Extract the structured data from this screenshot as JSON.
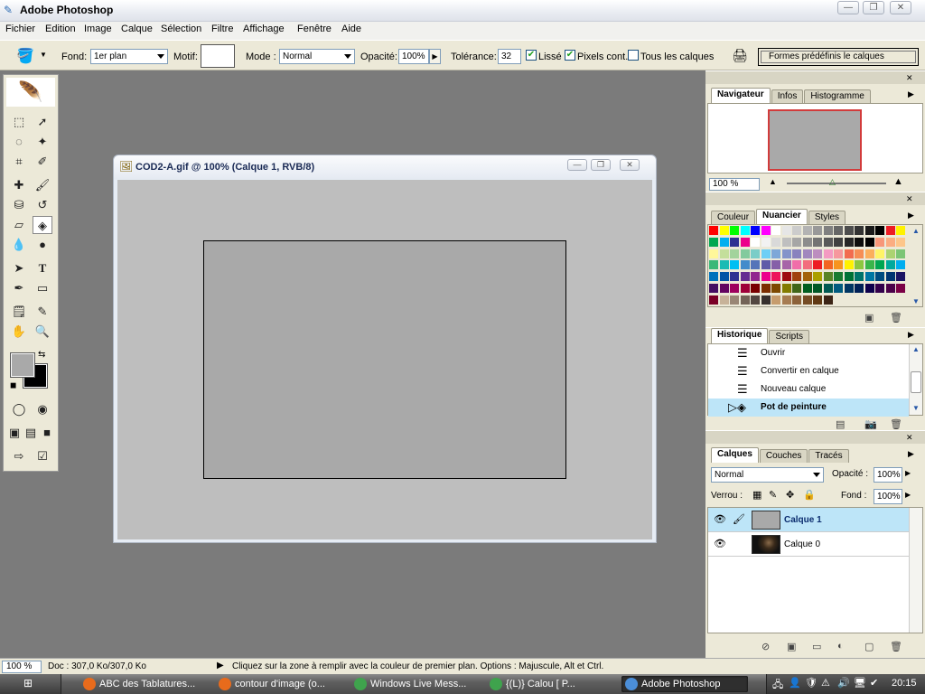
{
  "app": {
    "title": "Adobe Photoshop",
    "window_controls": [
      "—",
      "❐",
      "✕"
    ]
  },
  "menu": [
    "Fichier",
    "Edition",
    "Image",
    "Calque",
    "Sélection",
    "Filtre",
    "Affichage",
    "Fenêtre",
    "Aide"
  ],
  "options": {
    "fond_label": "Fond:",
    "fond_value": "1er plan",
    "motif_label": "Motif:",
    "mode_label": "Mode :",
    "mode_value": "Normal",
    "opacite_label": "Opacité:",
    "opacite_value": "100%",
    "tolerance_label": "Tolérance:",
    "tolerance_value": "32",
    "lisse_label": "Lissé",
    "pixels_label": "Pixels cont.",
    "tous_label": "Tous les calques",
    "palette_well": "Formes  prédéfinis   le calques"
  },
  "document": {
    "title": "COD2-A.gif @ 100% (Calque 1, RVB/8)"
  },
  "navigator": {
    "tabs": [
      "Navigateur",
      "Infos",
      "Histogramme"
    ],
    "zoom": "100 %"
  },
  "swatches_panel": {
    "tabs": [
      "Couleur",
      "Nuancier",
      "Styles"
    ]
  },
  "history_panel": {
    "tabs": [
      "Historique",
      "Scripts"
    ],
    "items": [
      "Ouvrir",
      "Convertir en calque",
      "Nouveau calque",
      "Pot de peinture"
    ]
  },
  "layers_panel": {
    "tabs": [
      "Calques",
      "Couches",
      "Tracés"
    ],
    "blend_mode": "Normal",
    "opacity_label": "Opacité :",
    "opacity_value": "100%",
    "lock_label": "Verrou :",
    "fill_label": "Fond :",
    "fill_value": "100%",
    "layers": [
      "Calque 1",
      "Calque 0"
    ]
  },
  "status": {
    "zoom": "100 %",
    "doc": "Doc : 307,0 Ko/307,0 Ko",
    "hint": "Cliquez sur la zone à remplir avec la couleur de premier plan. Options : Majuscule, Alt et Ctrl."
  },
  "taskbar": {
    "tasks": [
      "ABC des Tablatures...",
      "contour d'image (o...",
      "Windows Live Mess...",
      "{(L)}   Calou     [ P...",
      "Adobe Photoshop"
    ],
    "clock": "20:15"
  },
  "colors": {
    "fg_color": "#a9a9a9",
    "bg_color": "#000000",
    "selection_blue": "#bde5f8"
  }
}
